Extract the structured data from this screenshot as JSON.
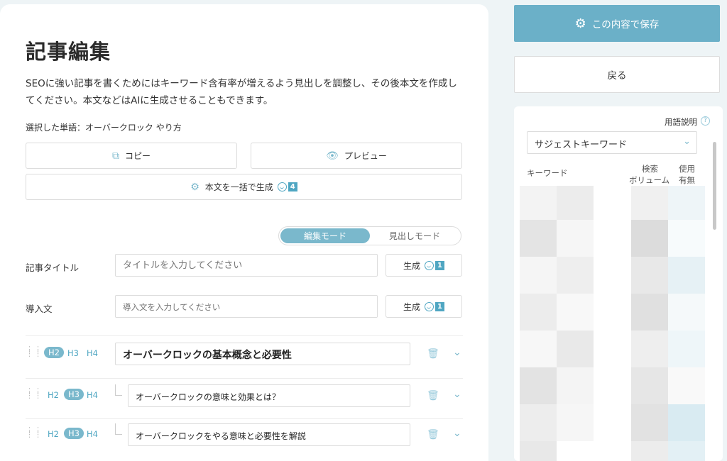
{
  "page": {
    "title": "記事編集",
    "description": "SEOに強い記事を書くためにはキーワード含有率が増えるよう見出しを調整し、その後本文を作成してください。本文などはAIに生成させることもできます。",
    "selected_word": "選択した単語：オーバークロック やり方"
  },
  "actions": {
    "copy_label": "コピー",
    "preview_label": "プレビュー",
    "bulk_generate_label": "本文を一括で生成",
    "bulk_generate_badge": "4"
  },
  "mode_toggle": {
    "edit_mode": "編集モード",
    "heading_mode": "見出しモード"
  },
  "fields": {
    "title_label": "記事タイトル",
    "title_placeholder": "タイトルを入力してください",
    "intro_label": "導入文",
    "intro_placeholder": "導入文を入力してください",
    "generate_label": "生成",
    "generate_badge": "1"
  },
  "headings": [
    {
      "level": "H2",
      "text": "オーバークロックの基本概念と必要性"
    },
    {
      "level": "H3",
      "text": "オーバークロックの意味と効果とは？"
    },
    {
      "level": "H3",
      "text": "オーバークロックをやる意味と必要性を解説"
    }
  ],
  "heading_levels": [
    "H2",
    "H3",
    "H4"
  ],
  "sidebar": {
    "save_label": "この内容で保存",
    "back_label": "戻る",
    "glossary_label": "用語説明",
    "help_icon_glyph": "?",
    "select_value": "サジェストキーワード",
    "col_keyword": "キーワード",
    "col_volume_1": "検索",
    "col_volume_2": "ボリューム",
    "col_used_1": "使用",
    "col_used_2": "有無"
  },
  "colors": {
    "accent": "#6bb0c8",
    "accent_light": "#7ab8cc",
    "background": "#eef4f6"
  }
}
